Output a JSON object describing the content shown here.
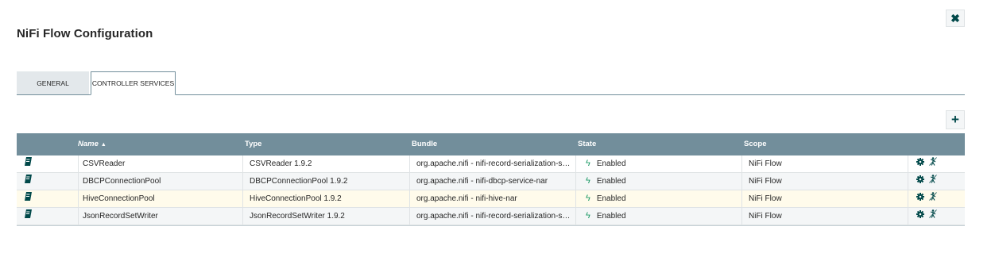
{
  "dialog": {
    "title": "NiFi Flow Configuration",
    "close_glyph": "✖"
  },
  "tabs": [
    {
      "label": "GENERAL",
      "active": false
    },
    {
      "label": "CONTROLLER SERVICES",
      "active": true
    }
  ],
  "toolbar": {
    "add_glyph": "+"
  },
  "table": {
    "columns": {
      "name": "Name",
      "name_sort": "▲",
      "type": "Type",
      "bundle": "Bundle",
      "state": "State",
      "scope": "Scope"
    },
    "rows": [
      {
        "name": "CSVReader",
        "type": "CSVReader 1.9.2",
        "bundle": "org.apache.nifi - nifi-record-serialization-ser…",
        "state": "Enabled",
        "scope": "NiFi Flow"
      },
      {
        "name": "DBCPConnectionPool",
        "type": "DBCPConnectionPool 1.9.2",
        "bundle": "org.apache.nifi - nifi-dbcp-service-nar",
        "state": "Enabled",
        "scope": "NiFi Flow"
      },
      {
        "name": "HiveConnectionPool",
        "type": "HiveConnectionPool 1.9.2",
        "bundle": "org.apache.nifi - nifi-hive-nar",
        "state": "Enabled",
        "scope": "NiFi Flow"
      },
      {
        "name": "JsonRecordSetWriter",
        "type": "JsonRecordSetWriter 1.9.2",
        "bundle": "org.apache.nifi - nifi-record-serialization-ser…",
        "state": "Enabled",
        "scope": "NiFi Flow"
      }
    ],
    "icons": {
      "row_icon": "document-icon",
      "state_icon": "bolt-icon",
      "action_1": "gear-icon",
      "action_2": "disable-icon"
    },
    "colors": {
      "header_bg": "#728e9b",
      "highlight_row": "#fffbeb",
      "enabled": "#1a9964"
    }
  }
}
